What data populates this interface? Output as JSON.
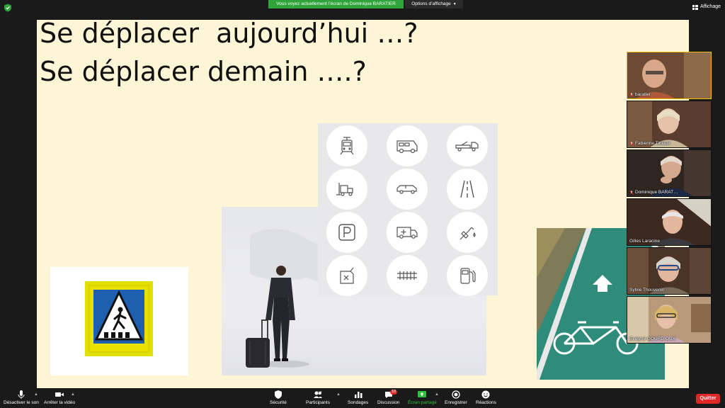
{
  "top_bar": {
    "share_banner": "Vous voyez actuellement l’écran de Dominique BARATIER",
    "view_options": "Options d’affichage",
    "affichage": "Affichage"
  },
  "slide": {
    "title_line1": "Se déplacer  aujourd’hui …?",
    "title_line2": "Se déplacer demain ….?",
    "icons": [
      "tram-icon",
      "camper-van-icon",
      "tow-truck-icon",
      "forklift-icon",
      "suv-car-icon",
      "road-icon",
      "parking-icon",
      "ambulance-icon",
      "fuel-nozzle-icon",
      "jerrycan-icon",
      "rail-track-icon",
      "fuel-pump-icon"
    ]
  },
  "participants": [
    {
      "name": "baratier",
      "active": true
    },
    {
      "name": "Fabienne Tirliaux",
      "active": false
    },
    {
      "name": "Dominique BARAT…",
      "active": false
    },
    {
      "name": "Gilles Laracine",
      "active": false
    },
    {
      "name": "Sylvie Thouvenin",
      "active": false
    },
    {
      "name": "Evelyne GOURDIOUX",
      "active": false
    }
  ],
  "toolbar": {
    "mute": "Désactiver le son",
    "stop_video": "Arrêter la vidéo",
    "security": "Sécurité",
    "participants": "Participants",
    "participants_count": "27",
    "polls": "Sondages",
    "chat": "Discussion",
    "chat_badge": "10",
    "share_screen": "Écran partagé",
    "record": "Enregistrer",
    "reactions": "Réactions",
    "quit": "Quitter"
  },
  "colors": {
    "share_green": "#2ea43a",
    "quit_red": "#e02828",
    "slide_bg": "#fdf6d6",
    "active_speaker": "#f2c200"
  }
}
